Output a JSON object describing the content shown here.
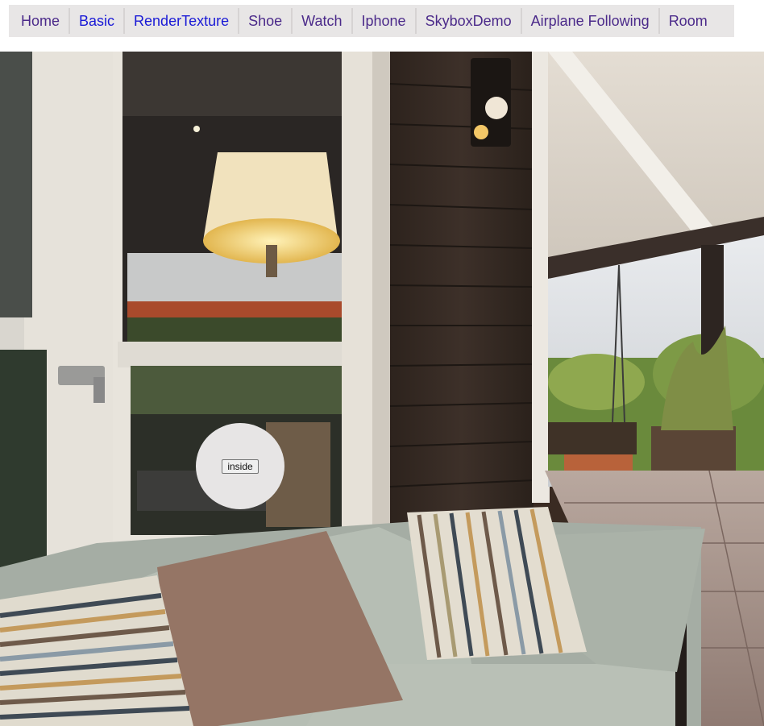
{
  "nav": {
    "items": [
      {
        "label": "Home",
        "color": "#4b2a8a"
      },
      {
        "label": "Basic",
        "color": "#1a1ad6"
      },
      {
        "label": "RenderTexture",
        "color": "#1a1ad6"
      },
      {
        "label": "Shoe",
        "color": "#4b2a8a"
      },
      {
        "label": "Watch",
        "color": "#4b2a8a"
      },
      {
        "label": "Iphone",
        "color": "#4b2a8a"
      },
      {
        "label": "SkyboxDemo",
        "color": "#4b2a8a"
      },
      {
        "label": "Airplane Following",
        "color": "#4b2a8a"
      },
      {
        "label": "Room",
        "color": "#4b2a8a"
      }
    ]
  },
  "scene": {
    "hotspot": {
      "button_label": "inside"
    }
  }
}
